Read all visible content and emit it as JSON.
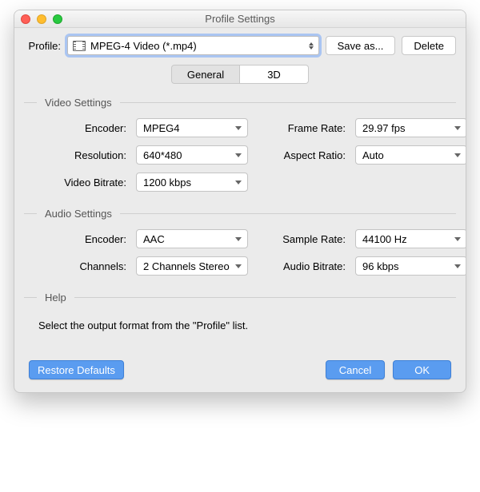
{
  "titlebar": {
    "title": "Profile Settings"
  },
  "profileRow": {
    "label": "Profile:",
    "value": "MPEG-4 Video (*.mp4)",
    "saveAs": "Save as...",
    "delete": "Delete"
  },
  "tabs": {
    "general": "General",
    "three_d": "3D",
    "active": "general"
  },
  "video": {
    "title": "Video Settings",
    "encoder": {
      "label": "Encoder:",
      "value": "MPEG4"
    },
    "frame_rate": {
      "label": "Frame Rate:",
      "value": "29.97 fps"
    },
    "resolution": {
      "label": "Resolution:",
      "value": "640*480"
    },
    "aspect_ratio": {
      "label": "Aspect Ratio:",
      "value": "Auto"
    },
    "bitrate": {
      "label": "Video Bitrate:",
      "value": "1200 kbps"
    }
  },
  "audio": {
    "title": "Audio Settings",
    "encoder": {
      "label": "Encoder:",
      "value": "AAC"
    },
    "sample_rate": {
      "label": "Sample Rate:",
      "value": "44100 Hz"
    },
    "channels": {
      "label": "Channels:",
      "value": "2 Channels Stereo"
    },
    "bitrate": {
      "label": "Audio Bitrate:",
      "value": "96 kbps"
    }
  },
  "help": {
    "title": "Help",
    "text": "Select the output format from the \"Profile\" list."
  },
  "footer": {
    "restore": "Restore Defaults",
    "cancel": "Cancel",
    "ok": "OK"
  }
}
